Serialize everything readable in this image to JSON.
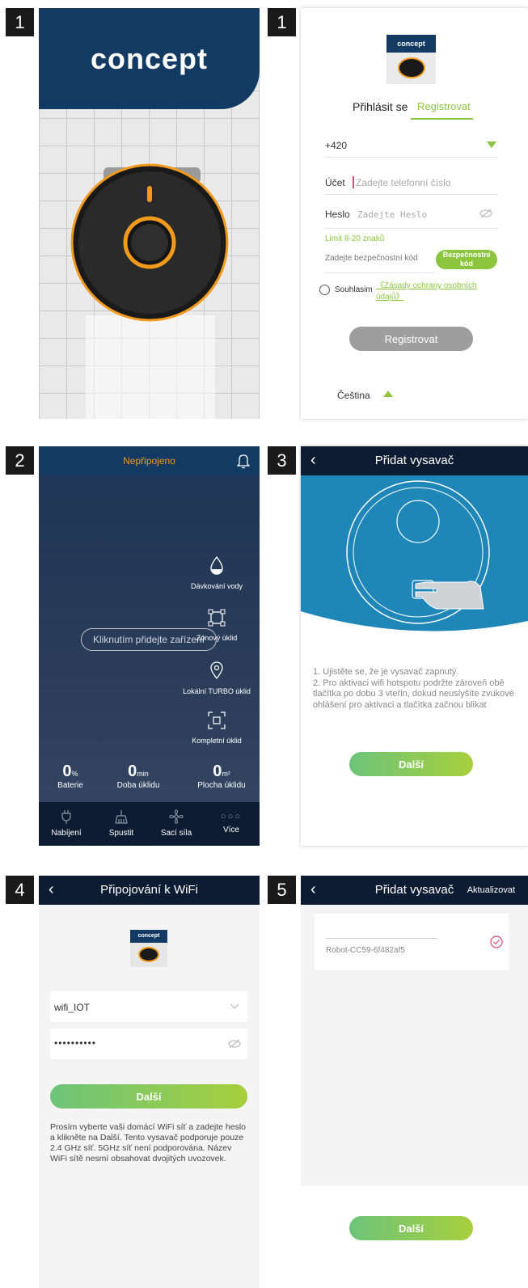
{
  "steps": [
    "1",
    "1",
    "2",
    "3",
    "4",
    "5"
  ],
  "splash": {
    "logo": "concept"
  },
  "register": {
    "logo": "concept",
    "tab_login": "Přihlásit se",
    "tab_register": "Registrovat",
    "country_code": "+420",
    "account_label": "Účet",
    "account_placeholder": "Zadejte telefonní číslo",
    "password_label": "Heslo",
    "password_placeholder": "Zadejte Heslo",
    "limit_hint": "Limit 8-20 znaků",
    "code_placeholder": "Zadejte bezpečnostní kód",
    "code_button": "Bezpečnostní kód",
    "agree_label": "Souhlasim",
    "privacy_link": "《Zásady ochrany osobních údajů》",
    "submit": "Registrovat",
    "language": "Čeština"
  },
  "home": {
    "status": "Nepřipojeno",
    "add_device": "Kliknutím přidejte zařízení",
    "modes": [
      "Dávkování vody",
      "Zónový úklid",
      "Lokální TURBO úklid",
      "Kompletní úklid"
    ],
    "stats": [
      {
        "value": "0",
        "unit": "%",
        "label": "Baterie"
      },
      {
        "value": "0",
        "unit": "min",
        "label": "Doba úklidu"
      },
      {
        "value": "0",
        "unit": "m²",
        "label": "Plocha úklidu"
      }
    ],
    "nav": [
      "Nabíjení",
      "Spustit",
      "Sací síla",
      "Více"
    ]
  },
  "add_vacuum": {
    "title": "Přidat vysavač",
    "instructions": "1. Ujistěte se, že je vysavač zapnutý.\n2. Pro aktivaci wifi hotspotu podržte zároveň obě tlačítka po dobu 3 vteřin, dokud neuslyšíte zvukové ohlášení pro aktivaci a tlačítka začnou blikat",
    "next": "Další"
  },
  "wifi": {
    "title": "Připojování k WiFi",
    "logo": "concept",
    "ssid": "wifi_IOT",
    "password_mask": "••••••••••",
    "next": "Další",
    "info": "Prosím vyberte vaši domácí WiFi síť a zadejte heslo a klikněte na Další. Tento vysavač podporuje pouze 2.4 GHz síť. 5GHz síť není podporována. Název WiFi sítě nesmí obsahovat dvojitých uvozovek."
  },
  "device_list": {
    "title": "Přidat vysavač",
    "refresh": "Aktualizovat",
    "device": "Robot-CC59-6f482af5",
    "next": "Další"
  },
  "colors": {
    "navy": "#123a63",
    "dark_bar": "#0e1c33",
    "accent_green": "#8cc63f",
    "orange": "#f29a1c",
    "sky_blue": "#1f86b8"
  },
  "icons": [
    "back-arrow-icon",
    "bell-icon",
    "water-drop-icon",
    "zone-icon",
    "location-pin-icon",
    "full-frame-icon",
    "plug-icon",
    "broom-icon",
    "fan-icon",
    "more-dots-icon",
    "eye-off-icon",
    "chevron-down-icon",
    "check-circle-icon"
  ]
}
